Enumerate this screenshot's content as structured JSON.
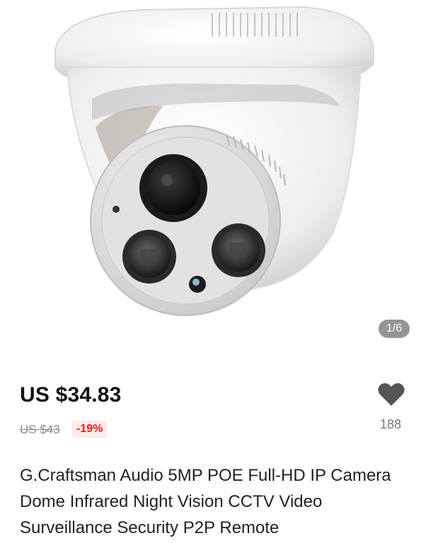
{
  "product": {
    "image_counter": "1/6",
    "price": "US $34.83",
    "original_price": "US $43",
    "discount": "-19%",
    "wishlist_icon": "heart-icon",
    "wishlist_count": "188",
    "title": "G.Craftsman Audio 5MP POE Full-HD IP Camera Dome Infrared Night Vision CCTV Video Surveillance Security P2P Remote"
  },
  "colors": {
    "discount_text": "#e02020",
    "discount_bg": "#fdeaea",
    "price_text": "#111111",
    "heart": "#555555"
  }
}
